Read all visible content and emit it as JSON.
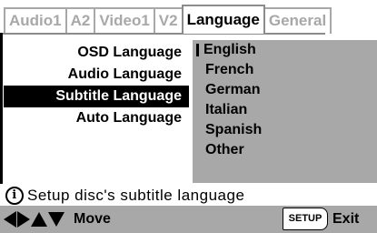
{
  "tabs": [
    {
      "label": "Audio1",
      "active": false
    },
    {
      "label": "A2",
      "active": false
    },
    {
      "label": "Video1",
      "active": false
    },
    {
      "label": "V2",
      "active": false
    },
    {
      "label": "Language",
      "active": true
    },
    {
      "label": "General",
      "active": false
    }
  ],
  "menu": {
    "items": [
      {
        "label": "OSD Language"
      },
      {
        "label": "Audio Language"
      },
      {
        "label": "Subtitle Language"
      },
      {
        "label": "Auto Language"
      }
    ],
    "selected_index": 2
  },
  "options": {
    "items": [
      {
        "label": "English"
      },
      {
        "label": "French"
      },
      {
        "label": "German"
      },
      {
        "label": "Italian"
      },
      {
        "label": "Spanish"
      },
      {
        "label": "Other"
      }
    ],
    "current_index": 0
  },
  "help": {
    "icon_glyph": "i",
    "text": "Setup disc's subtitle language"
  },
  "nav": {
    "move_label": "Move",
    "setup_key_label": "SETUP",
    "exit_label": "Exit"
  },
  "colors": {
    "panel_gray": "#a8a8a8",
    "selected_bg": "#000000",
    "selected_fg": "#ffffff"
  }
}
